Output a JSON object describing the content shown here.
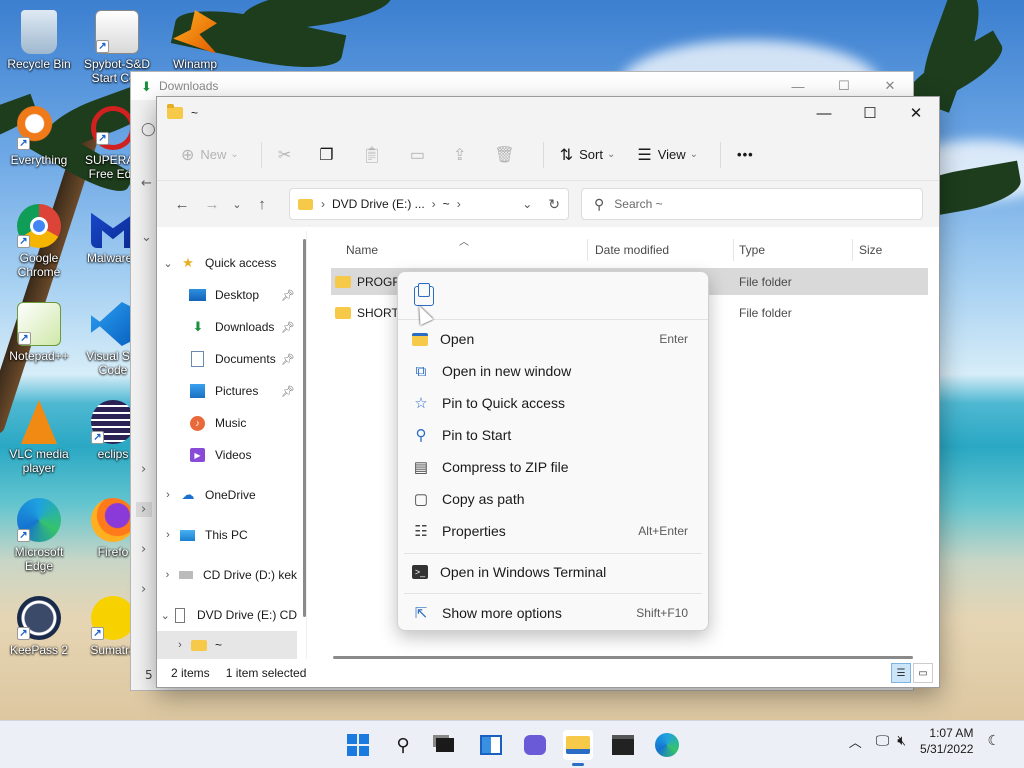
{
  "desktop": {
    "icons": [
      {
        "label": "Recycle Bin",
        "icon": "recycle-bin-icon"
      },
      {
        "label": "Spybot-S&D Start Cen",
        "icon": "spybot-icon"
      },
      {
        "label": "Winamp",
        "icon": "winamp-icon"
      },
      {
        "label": "Everything",
        "icon": "everything-icon"
      },
      {
        "label": "SUPERAn Free Edit",
        "icon": "superantispyware-icon"
      },
      {
        "label": "Google Chrome",
        "icon": "chrome-icon"
      },
      {
        "label": "Malwareb",
        "icon": "malwarebytes-icon"
      },
      {
        "label": "Notepad++",
        "icon": "notepadpp-icon"
      },
      {
        "label": "Visual Stu Code",
        "icon": "vscode-icon"
      },
      {
        "label": "VLC media player",
        "icon": "vlc-icon"
      },
      {
        "label": "eclips",
        "icon": "eclipse-icon"
      },
      {
        "label": "Microsoft Edge",
        "icon": "edge-icon"
      },
      {
        "label": "Firefo",
        "icon": "firefox-icon"
      },
      {
        "label": "KeePass 2",
        "icon": "keepass-icon"
      },
      {
        "label": "Sumatra",
        "icon": "sumatra-icon"
      }
    ]
  },
  "back_window": {
    "title": "Downloads",
    "status_partial": "5 i"
  },
  "window": {
    "title": "~",
    "controls": {
      "minimize": "—",
      "maximize": "☐",
      "close": "✕"
    }
  },
  "toolbar": {
    "new_label": "New",
    "sort_label": "Sort",
    "view_label": "View",
    "more_label": "•••"
  },
  "address": {
    "crumbs": [
      "DVD Drive (E:) ...",
      "~"
    ],
    "search_placeholder": "Search ~"
  },
  "nav": {
    "quick_access": "Quick access",
    "items": [
      {
        "label": "Desktop",
        "icon": "desktop-icon",
        "pinned": true
      },
      {
        "label": "Downloads",
        "icon": "downloads-icon",
        "pinned": true
      },
      {
        "label": "Documents",
        "icon": "documents-icon",
        "pinned": true
      },
      {
        "label": "Pictures",
        "icon": "pictures-icon",
        "pinned": true
      },
      {
        "label": "Music",
        "icon": "music-icon",
        "pinned": false
      },
      {
        "label": "Videos",
        "icon": "videos-icon",
        "pinned": false
      }
    ],
    "onedrive": "OneDrive",
    "thispc": "This PC",
    "cd_drive": "CD Drive (D:) kek",
    "dvd_drive": "DVD Drive (E:) CD",
    "current": "~"
  },
  "columns": {
    "name": "Name",
    "date": "Date modified",
    "type": "Type",
    "size": "Size"
  },
  "files": [
    {
      "name": "PROGRA",
      "type": "File folder",
      "selected": true
    },
    {
      "name": "SHORTC",
      "type": "File folder",
      "selected": false
    }
  ],
  "status": {
    "count": "2 items",
    "selected": "1 item selected"
  },
  "context_menu": {
    "items": [
      {
        "label": "Open",
        "accel": "Enter",
        "icon": "folder-open-icon"
      },
      {
        "label": "Open in new window",
        "accel": "",
        "icon": "open-new-window-icon"
      },
      {
        "label": "Pin to Quick access",
        "accel": "",
        "icon": "star-icon"
      },
      {
        "label": "Pin to Start",
        "accel": "",
        "icon": "pin-icon"
      },
      {
        "label": "Compress to ZIP file",
        "accel": "",
        "icon": "zip-icon"
      },
      {
        "label": "Copy as path",
        "accel": "",
        "icon": "copy-path-icon"
      },
      {
        "label": "Properties",
        "accel": "Alt+Enter",
        "icon": "properties-icon"
      },
      {
        "label": "Open in Windows Terminal",
        "accel": "",
        "icon": "terminal-icon"
      },
      {
        "label": "Show more options",
        "accel": "Shift+F10",
        "icon": "more-options-icon"
      }
    ]
  },
  "taskbar": {
    "time": "1:07 AM",
    "date": "5/31/2022"
  }
}
